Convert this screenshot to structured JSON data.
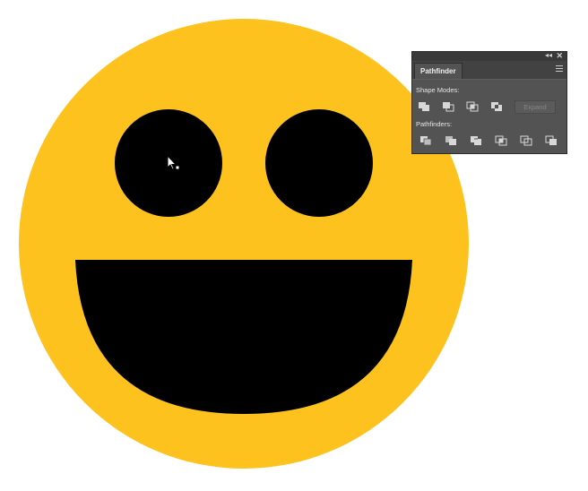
{
  "colors": {
    "face": "#FDC21E",
    "features": "#000000",
    "panel_bg": "#535353",
    "panel_text": "#e6e6e6"
  },
  "panel": {
    "title": "Pathfinder",
    "shape_modes_label": "Shape Modes:",
    "shape_mode_buttons": [
      "unite-icon",
      "minus-front-icon",
      "intersect-icon",
      "exclude-icon"
    ],
    "expand_label": "Expand",
    "pathfinders_label": "Pathfinders:",
    "pathfinder_buttons": [
      "divide-icon",
      "trim-icon",
      "merge-icon",
      "crop-icon",
      "outline-icon",
      "minus-back-icon"
    ]
  }
}
